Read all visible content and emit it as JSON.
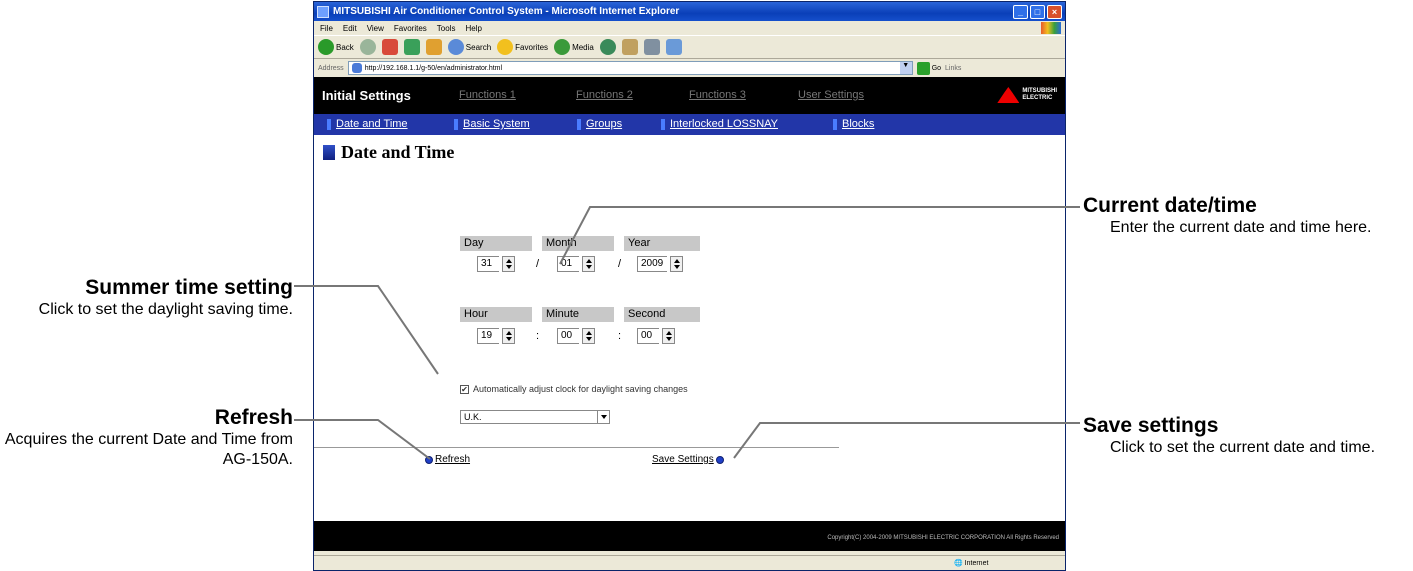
{
  "callouts": {
    "current_datetime": {
      "title": "Current date/time",
      "desc": "Enter the current date and time here."
    },
    "summer_time": {
      "title": "Summer time setting",
      "desc": "Click to set the daylight saving time."
    },
    "refresh": {
      "title": "Refresh",
      "desc": "Acquires the current Date and Time from AG-150A."
    },
    "save": {
      "title": "Save settings",
      "desc": "Click to set the current date and time."
    }
  },
  "browser": {
    "title": "MITSUBISHI Air Conditioner Control System - Microsoft Internet Explorer",
    "menu": [
      "File",
      "Edit",
      "View",
      "Favorites",
      "Tools",
      "Help"
    ],
    "toolbar": {
      "back": "Back",
      "search": "Search",
      "favorites": "Favorites",
      "media": "Media"
    },
    "address_label": "Address",
    "url": "http://192.168.1.1/g-50/en/administrator.html",
    "go": "Go",
    "links": "Links",
    "status_zone": "Internet"
  },
  "nav": {
    "current": "Initial Settings",
    "tabs": [
      "Functions 1",
      "Functions 2",
      "Functions 3",
      "User Settings"
    ],
    "subtabs": [
      "Date and Time",
      "Basic System",
      "Groups",
      "Interlocked LOSSNAY",
      "Blocks"
    ],
    "logo_line1": "MITSUBISHI",
    "logo_line2": "ELECTRIC"
  },
  "page": {
    "title": "Date and Time",
    "headers_date": [
      "Day",
      "Month",
      "Year"
    ],
    "date_values": {
      "day": "31",
      "month": "01",
      "year": "2009"
    },
    "date_sep": "/",
    "headers_time": [
      "Hour",
      "Minute",
      "Second"
    ],
    "time_values": {
      "hour": "19",
      "minute": "00",
      "second": "00"
    },
    "time_sep": ":",
    "dst_label": "Automatically adjust clock for daylight saving changes",
    "dst_checked": "✔",
    "dst_region": "U.K.",
    "refresh_label": "Refresh",
    "save_label": "Save Settings",
    "copyright": "Copyright(C) 2004-2009 MITSUBISHI ELECTRIC CORPORATION All Rights Reserved"
  }
}
